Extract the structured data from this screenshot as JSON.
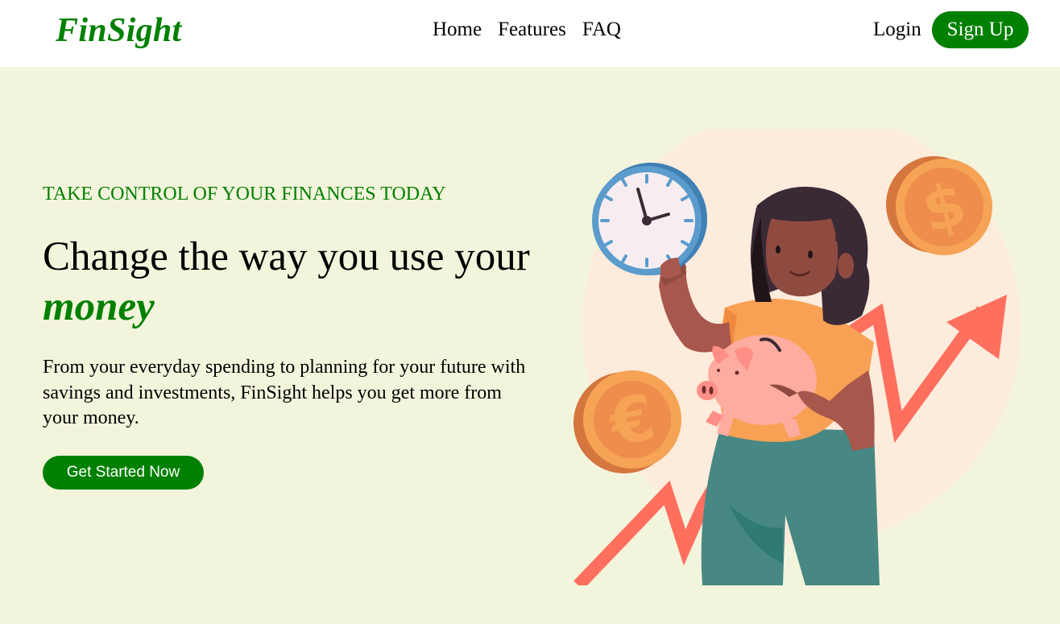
{
  "brand": {
    "name": "FinSight",
    "color": "#008000"
  },
  "nav": {
    "items": [
      {
        "label": "Home"
      },
      {
        "label": "Features"
      },
      {
        "label": "FAQ"
      }
    ]
  },
  "auth": {
    "login_label": "Login",
    "signup_label": "Sign Up"
  },
  "hero": {
    "eyebrow": "TAKE CONTROL OF YOUR FINANCES TODAY",
    "headline": "Change the way you use your",
    "headline_accent": "money",
    "description": "From your everyday spending to planning for your future with savings and investments, FinSight helps you get more from your money.",
    "cta_label": "Get Started Now"
  },
  "colors": {
    "accent": "#008000",
    "page_background": "#f3f4dc",
    "header_background": "#ffffff",
    "arrow": "#ff6f5e",
    "coin": "#f0954e"
  },
  "illustration": {
    "icons": [
      "clock-icon",
      "euro-coin-icon",
      "dollar-coin-icon",
      "piggy-bank-icon",
      "growth-arrow-icon"
    ]
  }
}
